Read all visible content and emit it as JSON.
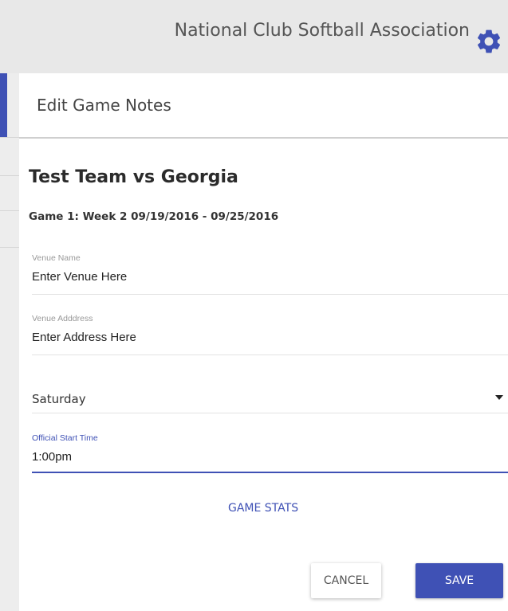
{
  "app": {
    "title": "National Club Softball Association",
    "settings_icon": "gear-icon"
  },
  "colors": {
    "accent": "#3f51b5",
    "topbar": "#e8e8e8",
    "background": "#eeeeee"
  },
  "dialog": {
    "title": "Edit Game Notes",
    "matchup": "Test Team vs Georgia",
    "game_info": "Game 1: Week 2 09/19/2016 - 09/25/2016",
    "venue_name": {
      "label": "Venue Name",
      "value": "Enter Venue Here"
    },
    "venue_address": {
      "label": "Venue Adddress",
      "value": "Enter Address Here"
    },
    "day_select": {
      "value": "Saturday",
      "icon": "caret-down-icon"
    },
    "start_time": {
      "label": "Official Start Time",
      "value": "1:00pm"
    },
    "game_stats_link": "GAME STATS",
    "cancel_label": "CANCEL",
    "save_label": "SAVE"
  }
}
